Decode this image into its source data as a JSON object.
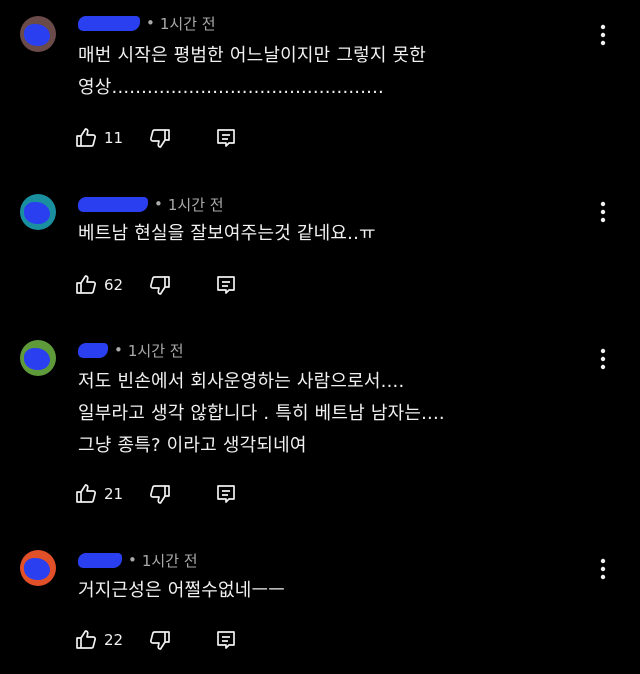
{
  "comments": [
    {
      "time": "1시간 전",
      "text": "매번 시작은 평범한 어느날이지만 그렇지 못한\n영상..............................................",
      "likes": "11",
      "avatar_color": "#6b4a4a"
    },
    {
      "time": "1시간 전",
      "text": "베트남 현실을 잘보여주는것 같네요..ㅠ",
      "likes": "62",
      "avatar_color": "#1a8fa0"
    },
    {
      "time": "1시간 전",
      "text": "저도 빈손에서 회사운영하는 사람으로서....\n일부라고 생각 않합니다 . 특히 베트남 남자는....\n그냥 종특? 이라고 생각되네여",
      "likes": "21",
      "avatar_color": "#5f9a3a"
    },
    {
      "time": "1시간 전",
      "text": "거지근성은 어쩔수없네ㅡㅡ",
      "likes": "22",
      "avatar_color": "#e2502a"
    }
  ],
  "icons": {
    "like": "thumb-up-icon",
    "dislike": "thumb-down-icon",
    "reply": "reply-comment-icon",
    "more": "more-vertical-icon"
  },
  "colors": {
    "background": "#000000",
    "text": "#f1f1f1",
    "meta": "#aaaaaa",
    "redaction": "#2a3ff0"
  },
  "meta_separator": "•"
}
